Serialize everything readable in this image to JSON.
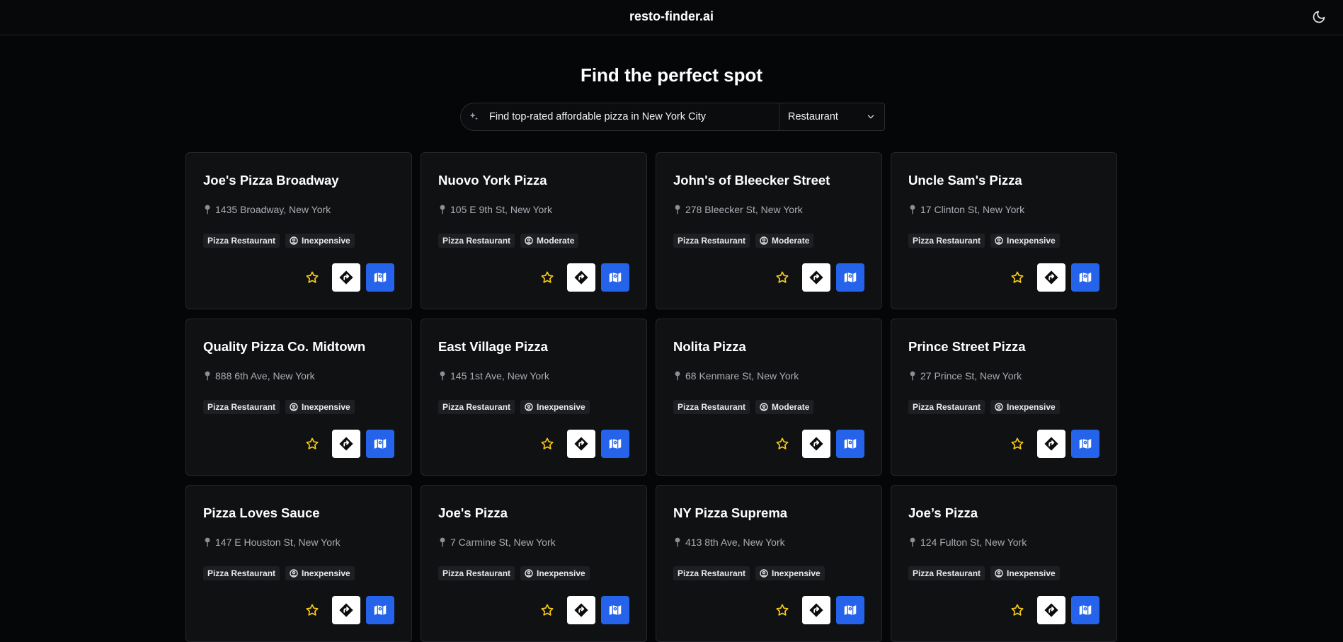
{
  "header": {
    "brand": "resto-finder.ai",
    "theme_icon": "moon-icon"
  },
  "hero": {
    "title": "Find the perfect spot"
  },
  "search": {
    "value": "Find top-rated affordable pizza in New York City",
    "type_value": "Restaurant"
  },
  "colors": {
    "background": "#050608",
    "card": "#101113",
    "accent": "#2563eb",
    "star": "#facc15"
  },
  "results": [
    {
      "name": "Joe's Pizza Broadway",
      "address": "1435 Broadway, New York",
      "category": "Pizza Restaurant",
      "price": "Inexpensive"
    },
    {
      "name": "Nuovo York Pizza",
      "address": "105 E 9th St, New York",
      "category": "Pizza Restaurant",
      "price": "Moderate"
    },
    {
      "name": "John's of Bleecker Street",
      "address": "278 Bleecker St, New York",
      "category": "Pizza Restaurant",
      "price": "Moderate"
    },
    {
      "name": "Uncle Sam's Pizza",
      "address": "17 Clinton St, New York",
      "category": "Pizza Restaurant",
      "price": "Inexpensive"
    },
    {
      "name": "Quality Pizza Co. Midtown",
      "address": "888 6th Ave, New York",
      "category": "Pizza Restaurant",
      "price": "Inexpensive"
    },
    {
      "name": "East Village Pizza",
      "address": "145 1st Ave, New York",
      "category": "Pizza Restaurant",
      "price": "Inexpensive"
    },
    {
      "name": "Nolita Pizza",
      "address": "68 Kenmare St, New York",
      "category": "Pizza Restaurant",
      "price": "Moderate"
    },
    {
      "name": "Prince Street Pizza",
      "address": "27 Prince St, New York",
      "category": "Pizza Restaurant",
      "price": "Inexpensive"
    },
    {
      "name": "Pizza Loves Sauce",
      "address": "147 E Houston St, New York",
      "category": "Pizza Restaurant",
      "price": "Inexpensive"
    },
    {
      "name": "Joe's Pizza",
      "address": "7 Carmine St, New York",
      "category": "Pizza Restaurant",
      "price": "Inexpensive"
    },
    {
      "name": "NY Pizza Suprema",
      "address": "413 8th Ave, New York",
      "category": "Pizza Restaurant",
      "price": "Inexpensive"
    },
    {
      "name": "Joe’s Pizza",
      "address": "124 Fulton St, New York",
      "category": "Pizza Restaurant",
      "price": "Inexpensive"
    }
  ]
}
